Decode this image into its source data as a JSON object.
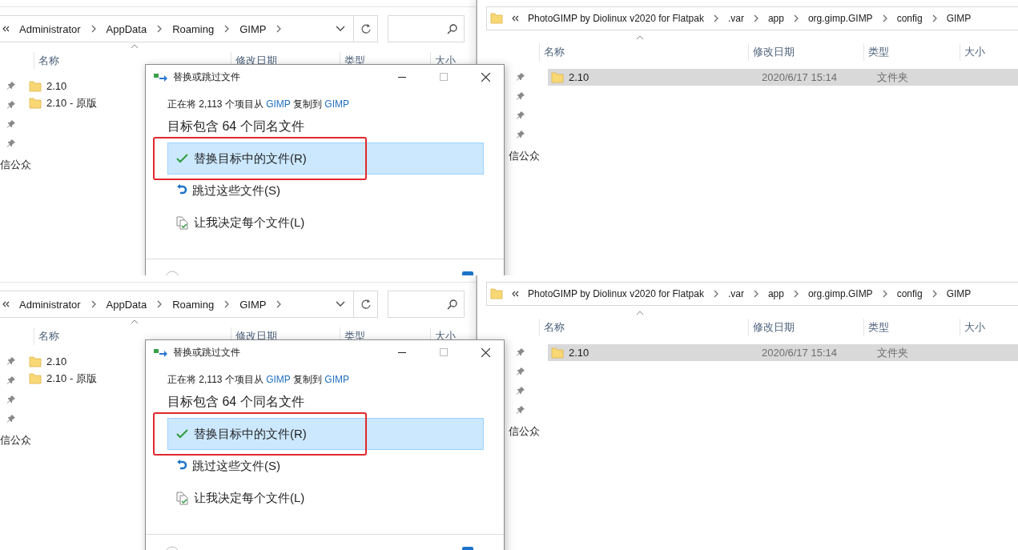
{
  "panels": [
    {
      "left_window": {
        "breadcrumb": [
          "Administrator",
          "AppData",
          "Roaming",
          "GIMP"
        ],
        "columns": [
          "名称",
          "修改日期",
          "类型",
          "大小"
        ],
        "nav_items": [
          "信公众"
        ],
        "files": [
          {
            "name": "2.10",
            "selected": false
          },
          {
            "name": "2.10 - 原版",
            "selected": false
          }
        ]
      },
      "right_window": {
        "breadcrumb": [
          "PhotoGIMP by Diolinux v2020 for Flatpak",
          ".var",
          "app",
          "org.gimp.GIMP",
          "config",
          "GIMP"
        ],
        "columns": [
          "名称",
          "修改日期",
          "类型",
          "大小"
        ],
        "nav_items": [
          "信公众"
        ],
        "files": [
          {
            "name": "2.10",
            "modified": "2020/6/17 15:14",
            "type": "文件夹",
            "selected": true
          }
        ]
      },
      "dialog": {
        "title": "替换或跳过文件",
        "status": {
          "before": "正在将 2,113 个项目从",
          "source": "GIMP",
          "middle": "复制到",
          "destination": "GIMP"
        },
        "heading": "目标包含 64 个同名文件",
        "options": [
          {
            "kind": "replace",
            "label": "替换目标中的文件(R)",
            "selected": true,
            "highlighted": true
          },
          {
            "kind": "skip",
            "label": "跳过这些文件(S)",
            "selected": false,
            "highlighted": false
          },
          {
            "kind": "decide",
            "label": "让我决定每个文件(L)",
            "selected": false,
            "highlighted": false
          }
        ]
      }
    },
    {
      "left_window": {
        "breadcrumb": [
          "Administrator",
          "AppData",
          "Roaming",
          "GIMP"
        ],
        "columns": [
          "名称",
          "修改日期",
          "类型",
          "大小"
        ],
        "nav_items": [
          "信公众"
        ],
        "files": [
          {
            "name": "2.10",
            "selected": false
          },
          {
            "name": "2.10 - 原版",
            "selected": false
          }
        ]
      },
      "right_window": {
        "breadcrumb": [
          "PhotoGIMP by Diolinux v2020 for Flatpak",
          ".var",
          "app",
          "org.gimp.GIMP",
          "config",
          "GIMP"
        ],
        "columns": [
          "名称",
          "修改日期",
          "类型",
          "大小"
        ],
        "nav_items": [
          "信公众"
        ],
        "files": [
          {
            "name": "2.10",
            "modified": "2020/6/17 15:14",
            "type": "文件夹",
            "selected": true
          }
        ]
      },
      "dialog": {
        "title": "替换或跳过文件",
        "status": {
          "before": "正在将 2,113 个项目从",
          "source": "GIMP",
          "middle": "复制到",
          "destination": "GIMP"
        },
        "heading": "目标包含 64 个同名文件",
        "options": [
          {
            "kind": "replace",
            "label": "替换目标中的文件(R)",
            "selected": true,
            "highlighted": true
          },
          {
            "kind": "skip",
            "label": "跳过这些文件(S)",
            "selected": false,
            "highlighted": false
          },
          {
            "kind": "decide",
            "label": "让我决定每个文件(L)",
            "selected": false,
            "highlighted": false
          }
        ]
      }
    }
  ]
}
